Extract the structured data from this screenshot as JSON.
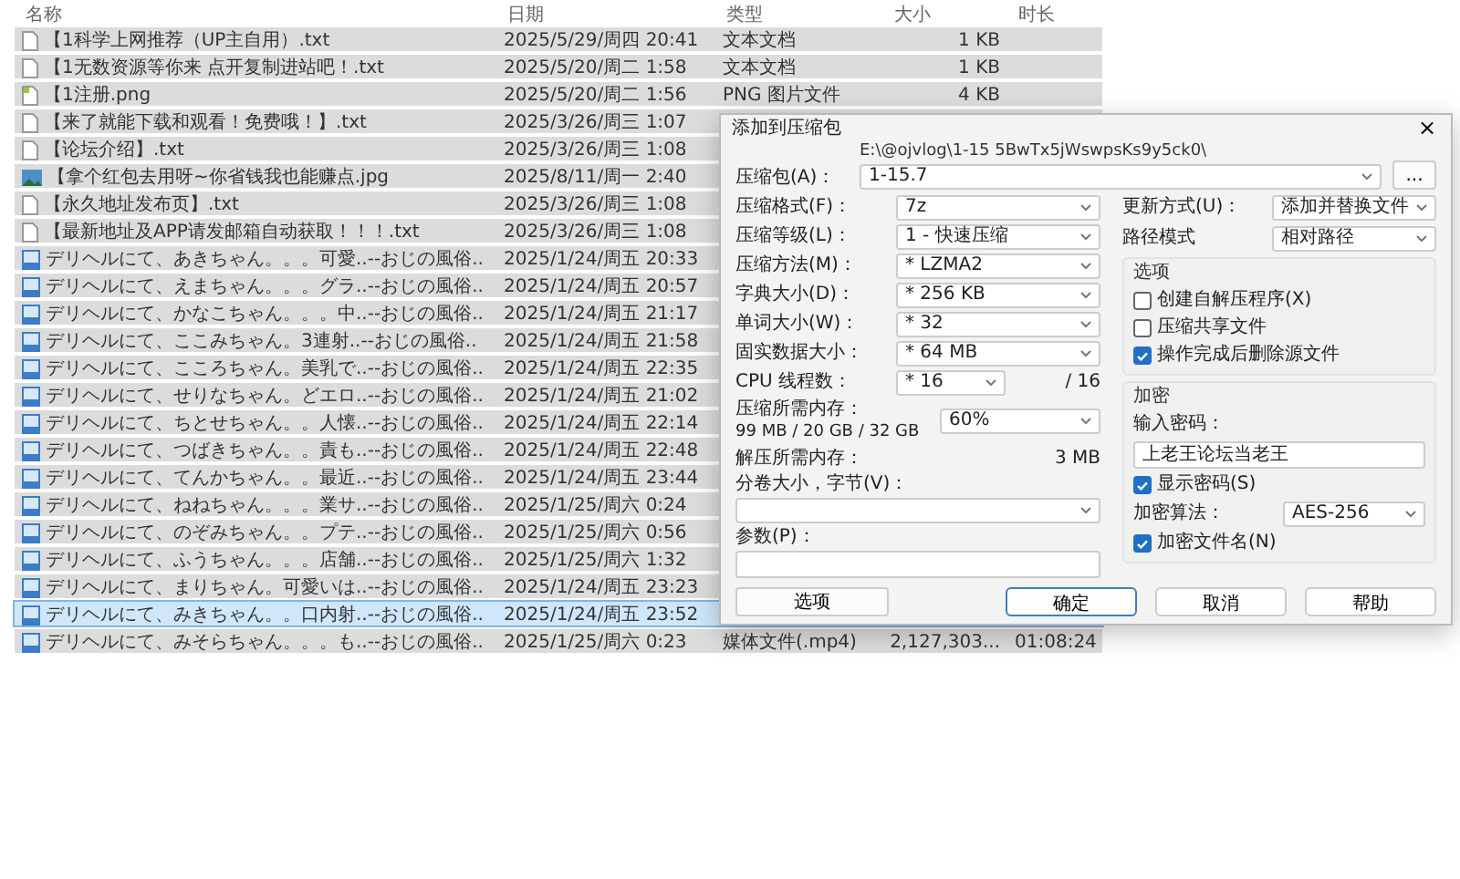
{
  "columns": [
    {
      "label": "名称"
    },
    {
      "label": "日期"
    },
    {
      "label": "类型"
    },
    {
      "label": "大小"
    },
    {
      "label": "时长"
    }
  ],
  "files": [
    {
      "kind": "text",
      "name": "【1科学上网推荐（UP主自用）.txt",
      "date": "2025/5/29/周四 20:41",
      "type": "文本文档",
      "size": "1 KB",
      "selected": false
    },
    {
      "kind": "text",
      "name": "【1无数资源等你来  点开复制进站吧！.txt",
      "date": "2025/5/20/周二 1:58",
      "type": "文本文档",
      "size": "1 KB",
      "selected": false
    },
    {
      "kind": "image",
      "name": "【1注册.png",
      "date": "2025/5/20/周二 1:56",
      "type": "PNG 图片文件",
      "size": "4 KB",
      "selected": false
    },
    {
      "kind": "text",
      "name": "【来了就能下载和观看！免费哦！】.txt",
      "date": "2025/3/26/周三 1:07",
      "selected": false
    },
    {
      "kind": "text",
      "name": "【论坛介绍】.txt",
      "date": "2025/3/26/周三 1:08",
      "selected": false
    },
    {
      "kind": "photo",
      "name": "【拿个红包去用呀~你省钱我也能赚点.jpg",
      "date": "2025/8/11/周一 2:40",
      "selected": false
    },
    {
      "kind": "text",
      "name": "【永久地址发布页】.txt",
      "date": "2025/3/26/周三 1:08",
      "selected": false
    },
    {
      "kind": "text",
      "name": "【最新地址及APP请发邮箱自动获取！！！.txt",
      "date": "2025/3/26/周三 1:08",
      "selected": false
    },
    {
      "kind": "video",
      "name": "デリヘルにて、あきちゃん。。。可愛..--おじの風俗..",
      "date": "2025/1/24/周五 20:33",
      "selected": false
    },
    {
      "kind": "video",
      "name": "デリヘルにて、えまちゃん。。。グラ..--おじの風俗..",
      "date": "2025/1/24/周五 20:57",
      "selected": false
    },
    {
      "kind": "video",
      "name": "デリヘルにて、かなこちゃん。。。中..--おじの風俗..",
      "date": "2025/1/24/周五 21:17",
      "selected": false
    },
    {
      "kind": "video",
      "name": "デリヘルにて、ここみちゃん。3連射..--おじの風俗..",
      "date": "2025/1/24/周五 21:58",
      "selected": false
    },
    {
      "kind": "video",
      "name": "デリヘルにて、こころちゃん。美乳で..--おじの風俗..",
      "date": "2025/1/24/周五 22:35",
      "selected": false
    },
    {
      "kind": "video",
      "name": "デリヘルにて、せりなちゃん。どエロ..--おじの風俗..",
      "date": "2025/1/24/周五 21:02",
      "selected": false
    },
    {
      "kind": "video",
      "name": "デリヘルにて、ちとせちゃん。。人懐..--おじの風俗..",
      "date": "2025/1/24/周五 22:14",
      "selected": false
    },
    {
      "kind": "video",
      "name": "デリヘルにて、つばきちゃん。。責も..--おじの風俗..",
      "date": "2025/1/24/周五 22:48",
      "selected": false
    },
    {
      "kind": "video",
      "name": "デリヘルにて、てんかちゃん。。最近..--おじの風俗..",
      "date": "2025/1/24/周五 23:44",
      "selected": false
    },
    {
      "kind": "video",
      "name": "デリヘルにて、ねねちゃん。。。業サ..--おじの風俗..",
      "date": "2025/1/25/周六 0:24",
      "selected": false
    },
    {
      "kind": "video",
      "name": "デリヘルにて、のぞみちゃん。。プテ..--おじの風俗..",
      "date": "2025/1/25/周六 0:56",
      "selected": false
    },
    {
      "kind": "video",
      "name": "デリヘルにて、ふうちゃん。。。店舗..--おじの風俗..",
      "date": "2025/1/25/周六 1:32",
      "selected": false
    },
    {
      "kind": "video",
      "name": "デリヘルにて、まりちゃん。可愛いは..--おじの風俗..",
      "date": "2025/1/24/周五 23:23",
      "selected": false
    },
    {
      "kind": "video",
      "name": "デリヘルにて、みきちゃん。。口内射..--おじの風俗..",
      "date": "2025/1/24/周五 23:52",
      "selected": true
    },
    {
      "kind": "video",
      "name": "デリヘルにて、みそらちゃん。。。も..--おじの風俗..",
      "date": "2025/1/25/周六 0:23",
      "type": "媒体文件(.mp4)",
      "size": "2,127,303...",
      "duration": "01:08:24",
      "selected": false
    }
  ],
  "dialog": {
    "title": "添加到压缩包",
    "close": "×",
    "archive": {
      "label": "压缩包(A)：",
      "path": "E:\\@ojvlog\\1-15 5BwTx5jWswpsKs9y5ck0\\",
      "value": "1-15.7",
      "browse": "..."
    },
    "left_fields": [
      {
        "kind": "select",
        "label": "压缩格式(F)：",
        "value": "7z"
      },
      {
        "kind": "select",
        "label": "压缩等级(L)：",
        "value": "1 - 快速压缩"
      },
      {
        "kind": "select",
        "label": "压缩方法(M)：",
        "value": "* LZMA2"
      },
      {
        "kind": "select",
        "label": "字典大小(D)：",
        "value": "* 256 KB"
      },
      {
        "kind": "select",
        "label": "单词大小(W)：",
        "value": "* 32"
      },
      {
        "kind": "select",
        "label": "固实数据大小：",
        "value": "* 64 MB"
      },
      {
        "kind": "threads",
        "label": "CPU 线程数：",
        "value": "* 16",
        "suffix": "/ 16"
      },
      {
        "kind": "memory",
        "label": "压缩所需内存：",
        "detail": "99 MB / 20 GB / 32 GB",
        "value": "60%"
      },
      {
        "kind": "info",
        "label": "解压所需内存：",
        "value": "3 MB"
      },
      {
        "kind": "wide_select",
        "label": "分卷大小，字节(V)："
      },
      {
        "kind": "wide_input",
        "label": "参数(P)："
      }
    ],
    "options_button": "选项",
    "right_fields": [
      {
        "label": "更新方式(U)：",
        "value": "添加并替换文件"
      },
      {
        "label": "路径模式",
        "value": "相对路径"
      }
    ],
    "options_group": {
      "title": "选项",
      "checkboxes": [
        {
          "label": "创建自解压程序(X)",
          "checked": false
        },
        {
          "label": "压缩共享文件",
          "checked": false
        },
        {
          "label": "操作完成后删除源文件",
          "checked": true
        }
      ]
    },
    "encryption": {
      "title": "加密",
      "password_label": "输入密码：",
      "password": "上老王论坛当老王",
      "show_password": {
        "label": "显示密码(S)",
        "checked": true
      },
      "method_label": "加密算法：",
      "method": "AES-256",
      "encrypt_names": {
        "label": "加密文件名(N)",
        "checked": true
      }
    },
    "buttons": [
      "确定",
      "取消",
      "帮助"
    ]
  }
}
